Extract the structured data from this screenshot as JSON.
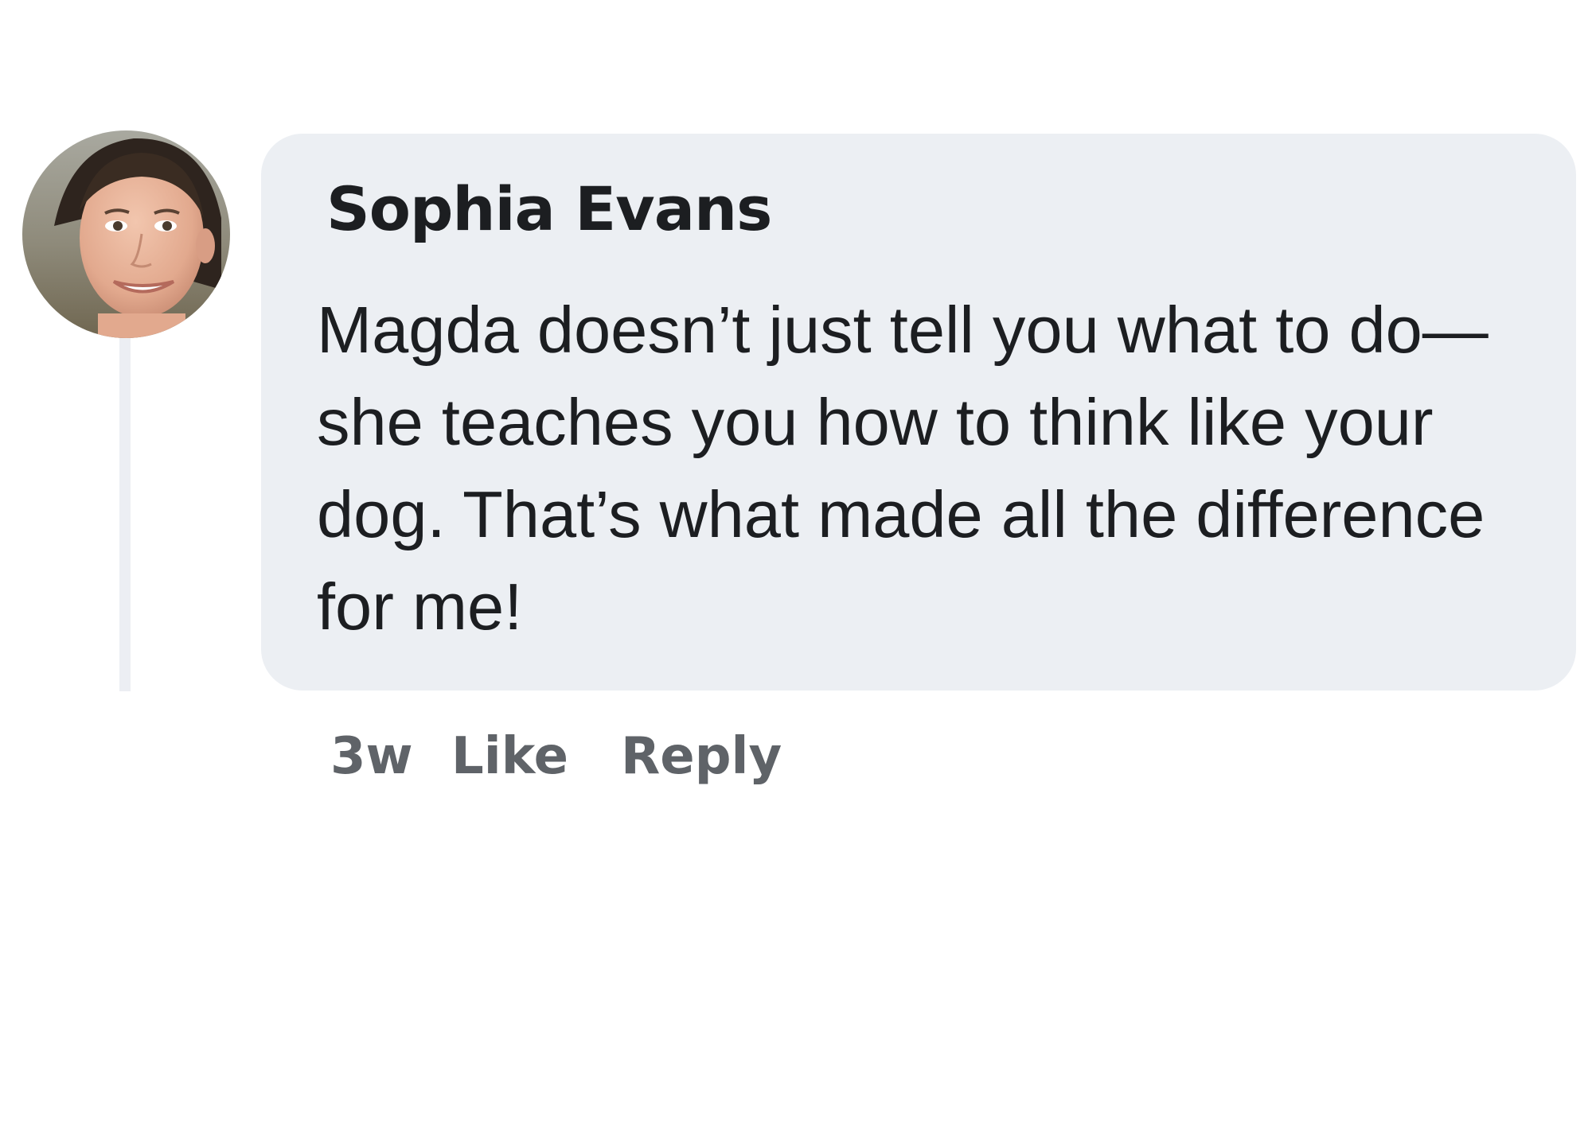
{
  "comment": {
    "author": "Sophia Evans",
    "avatar_icon": "user-photo-avatar",
    "text_lines": [
      "Magda doesn’t just tell you what to do—",
      "she teaches you how to think like your",
      "dog. That’s what made all the difference",
      "for me!"
    ],
    "timestamp": "3w",
    "like_label": "Like",
    "reply_label": "Reply"
  },
  "colors": {
    "bubble_background": "#eceff3",
    "text": "#1c1e21",
    "meta_text": "#5f6368",
    "thread_line": "#eceef3"
  }
}
